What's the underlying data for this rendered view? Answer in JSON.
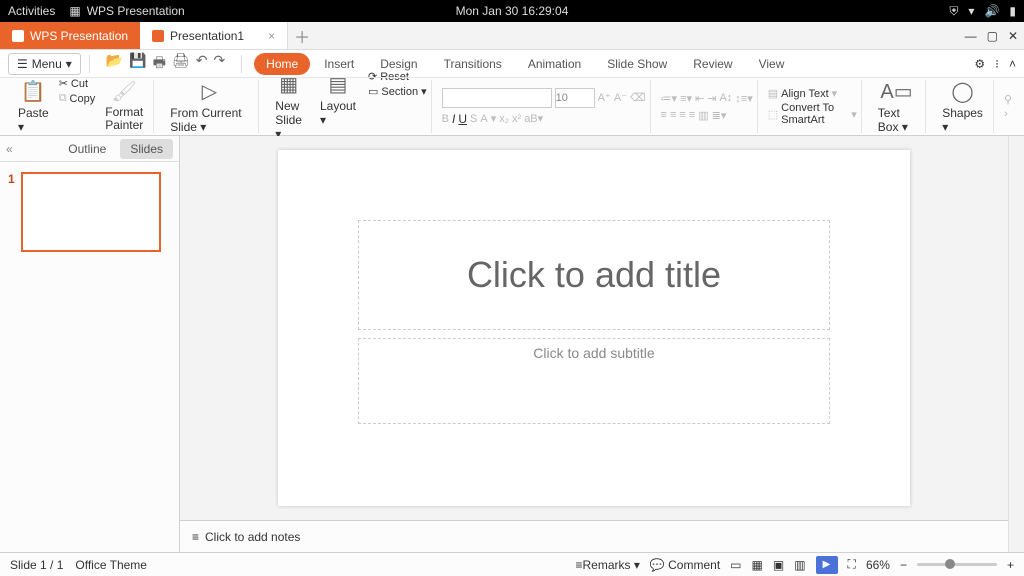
{
  "topbar": {
    "activities": "Activities",
    "app": "WPS Presentation",
    "datetime": "Mon Jan 30  16:29:04"
  },
  "tabs": {
    "app": "WPS Presentation",
    "doc": "Presentation1"
  },
  "menu": {
    "label": "Menu"
  },
  "ribbonTabs": [
    "Home",
    "Insert",
    "Design",
    "Transitions",
    "Animation",
    "Slide Show",
    "Review",
    "View"
  ],
  "ribbon": {
    "paste": "Paste",
    "cut": "Cut",
    "copy": "Copy",
    "formatPainter": "Format Painter",
    "fromCurrent": "From Current Slide",
    "newSlide": "New Slide",
    "layout": "Layout",
    "reset": "Reset",
    "section": "Section",
    "fontSize": "10",
    "alignText": "Align Text",
    "convertSmart": "Convert To SmartArt",
    "textBox": "Text Box",
    "shapes": "Shapes"
  },
  "side": {
    "outline": "Outline",
    "slides": "Slides",
    "slideNum": "1"
  },
  "slide": {
    "title": "Click to add title",
    "subtitle": "Click to add subtitle"
  },
  "notes": {
    "placeholder": "Click to add notes"
  },
  "status": {
    "slide": "Slide 1 / 1",
    "theme": "Office Theme",
    "remarks": "Remarks",
    "comment": "Comment",
    "zoom": "66%"
  }
}
